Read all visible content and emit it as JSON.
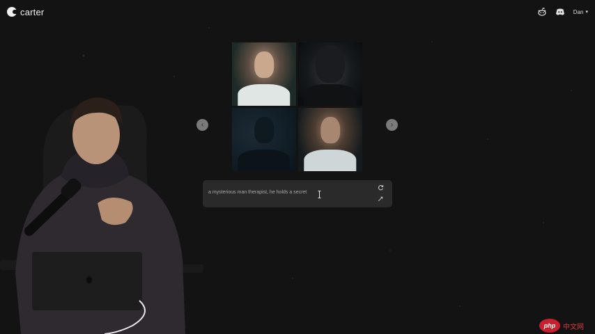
{
  "app": {
    "brand_name": "carter"
  },
  "header": {
    "user_name": "Dan",
    "icons": [
      "reddit-icon",
      "discord-icon"
    ]
  },
  "gallery": {
    "image_count": 4,
    "prev_icon": "chevron-left-icon",
    "next_icon": "chevron-right-icon"
  },
  "prompt": {
    "text": "a mysterious man therapist, he holds a secret",
    "refresh_icon": "refresh-icon",
    "expand_icon": "expand-icon"
  },
  "watermark": {
    "badge": "php",
    "text": "中文网"
  },
  "colors": {
    "background": "#131313",
    "panel": "#2a2a2a",
    "arrow": "#7a7a7a",
    "watermark": "#c8202f"
  }
}
